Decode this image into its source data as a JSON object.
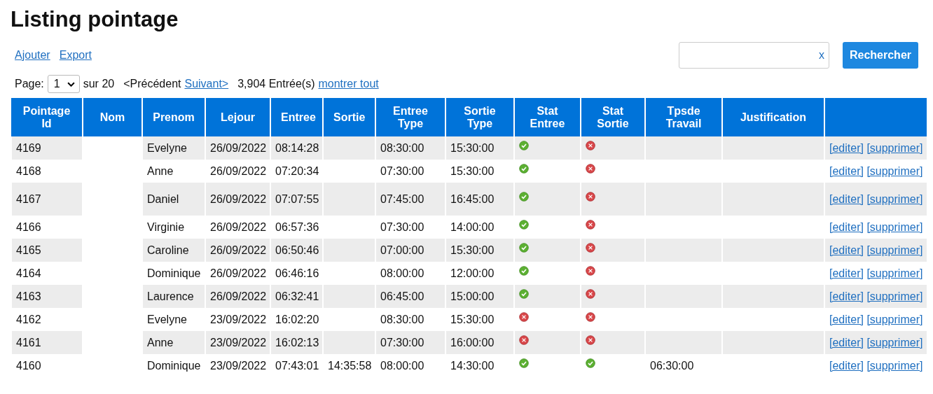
{
  "title": "Listing pointage",
  "links": [
    "Ajouter",
    "Export"
  ],
  "search": {
    "clear": "x",
    "button": "Rechercher"
  },
  "pagination": {
    "label": "Page:",
    "page": "1",
    "of": "sur 20",
    "previous": "<Précédent",
    "next": "Suivant>",
    "count": "3,904 Entrée(s)",
    "show_all": "montrer tout"
  },
  "table": {
    "columns": [
      "Pointage Id",
      "Nom",
      "Prenom",
      "Lejour",
      "Entree",
      "Sortie",
      "Entree Type",
      "Sortie Type",
      "Stat Entree",
      "Stat Sortie",
      "Tpsde Travail",
      "Justification"
    ],
    "rows": [
      {
        "id": "4169",
        "prenom": "Evelyne",
        "lejour": "26/09/2022",
        "entree": "08:14:28",
        "entree_type": "08:30:00",
        "sortie_type": "15:30:00",
        "stat_entree": true,
        "stat_sortie": false,
        "edit": "[editer]",
        "delete": "[supprimer]"
      },
      {
        "id": "4168",
        "prenom": "Anne",
        "lejour": "26/09/2022",
        "entree": "07:20:34",
        "entree_type": "07:30:00",
        "sortie_type": "15:30:00",
        "stat_entree": true,
        "stat_sortie": false,
        "edit": "[editer]",
        "delete": "[supprimer]"
      },
      {
        "id": "4167",
        "prenom": "Daniel",
        "lejour": "26/09/2022",
        "entree": "07:07:55",
        "entree_type": "07:45:00",
        "sortie_type": "16:45:00",
        "stat_entree": true,
        "stat_sortie": false,
        "edit": "[editer]",
        "delete": "[supprimer]"
      },
      {
        "id": "4166",
        "prenom": "Virginie",
        "lejour": "26/09/2022",
        "entree": "06:57:36",
        "entree_type": "07:30:00",
        "sortie_type": "14:00:00",
        "stat_entree": true,
        "stat_sortie": false,
        "edit": "[editer]",
        "delete": "[supprimer]"
      },
      {
        "id": "4165",
        "prenom": "Caroline",
        "lejour": "26/09/2022",
        "entree": "06:50:46",
        "entree_type": "07:00:00",
        "sortie_type": "15:30:00",
        "stat_entree": true,
        "stat_sortie": false,
        "edit": "[editer]",
        "delete": "[supprimer]"
      },
      {
        "id": "4164",
        "prenom": "Dominique",
        "lejour": "26/09/2022",
        "entree": "06:46:16",
        "entree_type": "08:00:00",
        "sortie_type": "12:00:00",
        "stat_entree": true,
        "stat_sortie": false,
        "edit": "[editer]",
        "delete": "[supprimer]"
      },
      {
        "id": "4163",
        "prenom": "Laurence",
        "lejour": "26/09/2022",
        "entree": "06:32:41",
        "entree_type": "06:45:00",
        "sortie_type": "15:00:00",
        "stat_entree": true,
        "stat_sortie": false,
        "edit": "[editer]",
        "delete": "[supprimer]"
      },
      {
        "id": "4162",
        "prenom": "Evelyne",
        "lejour": "23/09/2022",
        "entree": "16:02:20",
        "entree_type": "08:30:00",
        "sortie_type": "15:30:00",
        "stat_entree": false,
        "stat_sortie": false,
        "edit": "[editer]",
        "delete": "[supprimer]"
      },
      {
        "id": "4161",
        "prenom": "Anne",
        "lejour": "23/09/2022",
        "entree": "16:02:13",
        "entree_type": "07:30:00",
        "sortie_type": "16:00:00",
        "stat_entree": false,
        "stat_sortie": false,
        "edit": "[editer]",
        "delete": "[supprimer]"
      },
      {
        "id": "4160",
        "prenom": "Dominique",
        "lejour": "23/09/2022",
        "entree": "07:43:01",
        "sortie": "14:35:58",
        "entree_type": "08:00:00",
        "sortie_type": "14:30:00",
        "stat_entree": true,
        "stat_sortie": true,
        "travail": "06:30:00",
        "edit": "[editer]",
        "delete": "[supprimer]"
      }
    ]
  }
}
